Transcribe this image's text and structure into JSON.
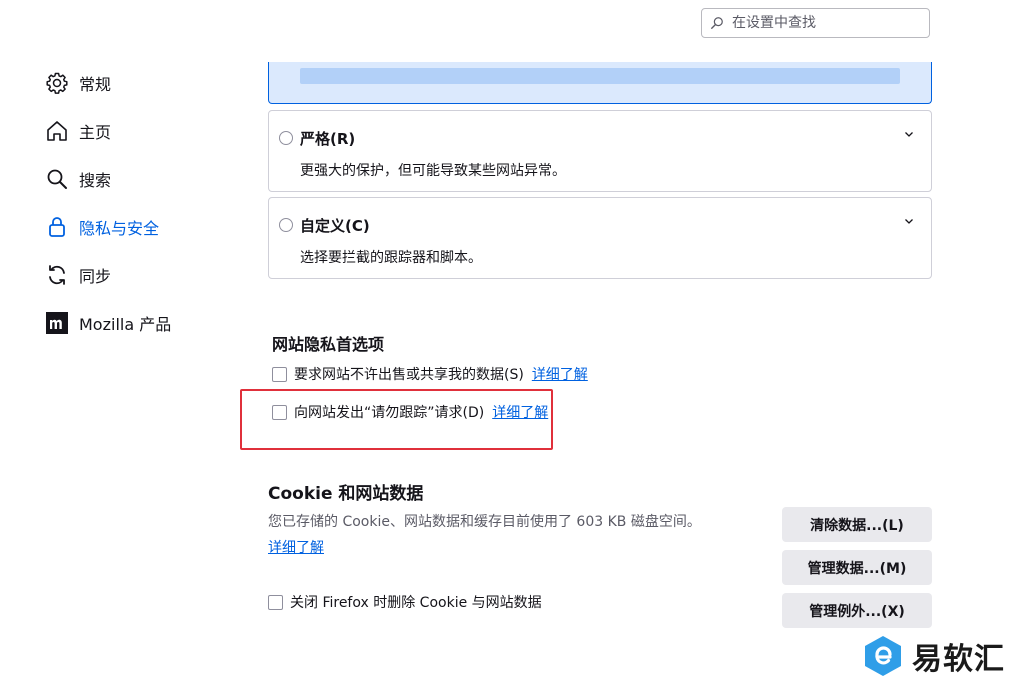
{
  "search": {
    "placeholder": "在设置中查找"
  },
  "sidebar": {
    "items": [
      {
        "label": "常规",
        "icon": "gear-icon"
      },
      {
        "label": "主页",
        "icon": "home-icon"
      },
      {
        "label": "搜索",
        "icon": "search-icon"
      },
      {
        "label": "隐私与安全",
        "icon": "lock-icon",
        "active": true
      },
      {
        "label": "同步",
        "icon": "sync-icon"
      },
      {
        "label": "Mozilla 产品",
        "icon": "mozilla-logo-icon"
      }
    ]
  },
  "protection": {
    "options": [
      {
        "title": "严格(R)",
        "desc": "更强大的保护，但可能导致某些网站异常。"
      },
      {
        "title": "自定义(C)",
        "desc": "选择要拦截的跟踪器和脚本。"
      }
    ]
  },
  "privacy_prefs": {
    "heading": "网站隐私首选项",
    "items": [
      {
        "label": "要求网站不许出售或共享我的数据(S)",
        "link": "详细了解",
        "checked": false
      },
      {
        "label": "向网站发出“请勿跟踪”请求(D)",
        "link": "详细了解",
        "checked": false
      }
    ]
  },
  "cookies": {
    "heading": "Cookie 和网站数据",
    "desc": "您已存储的 Cookie、网站数据和缓存目前使用了 603 KB 磁盘空间。",
    "learn_more": "详细了解",
    "clear_button": "清除数据...(L)",
    "manage_button": "管理数据...(M)",
    "exceptions_button": "管理例外...(X)",
    "delete_on_close": "关闭 Firefox 时删除 Cookie 与网站数据",
    "delete_on_close_checked": false
  },
  "watermark": {
    "text": "易软汇"
  },
  "colors": {
    "accent": "#0061e0",
    "highlight_box": "#e0303b",
    "button_bg": "#e9e9ed"
  }
}
